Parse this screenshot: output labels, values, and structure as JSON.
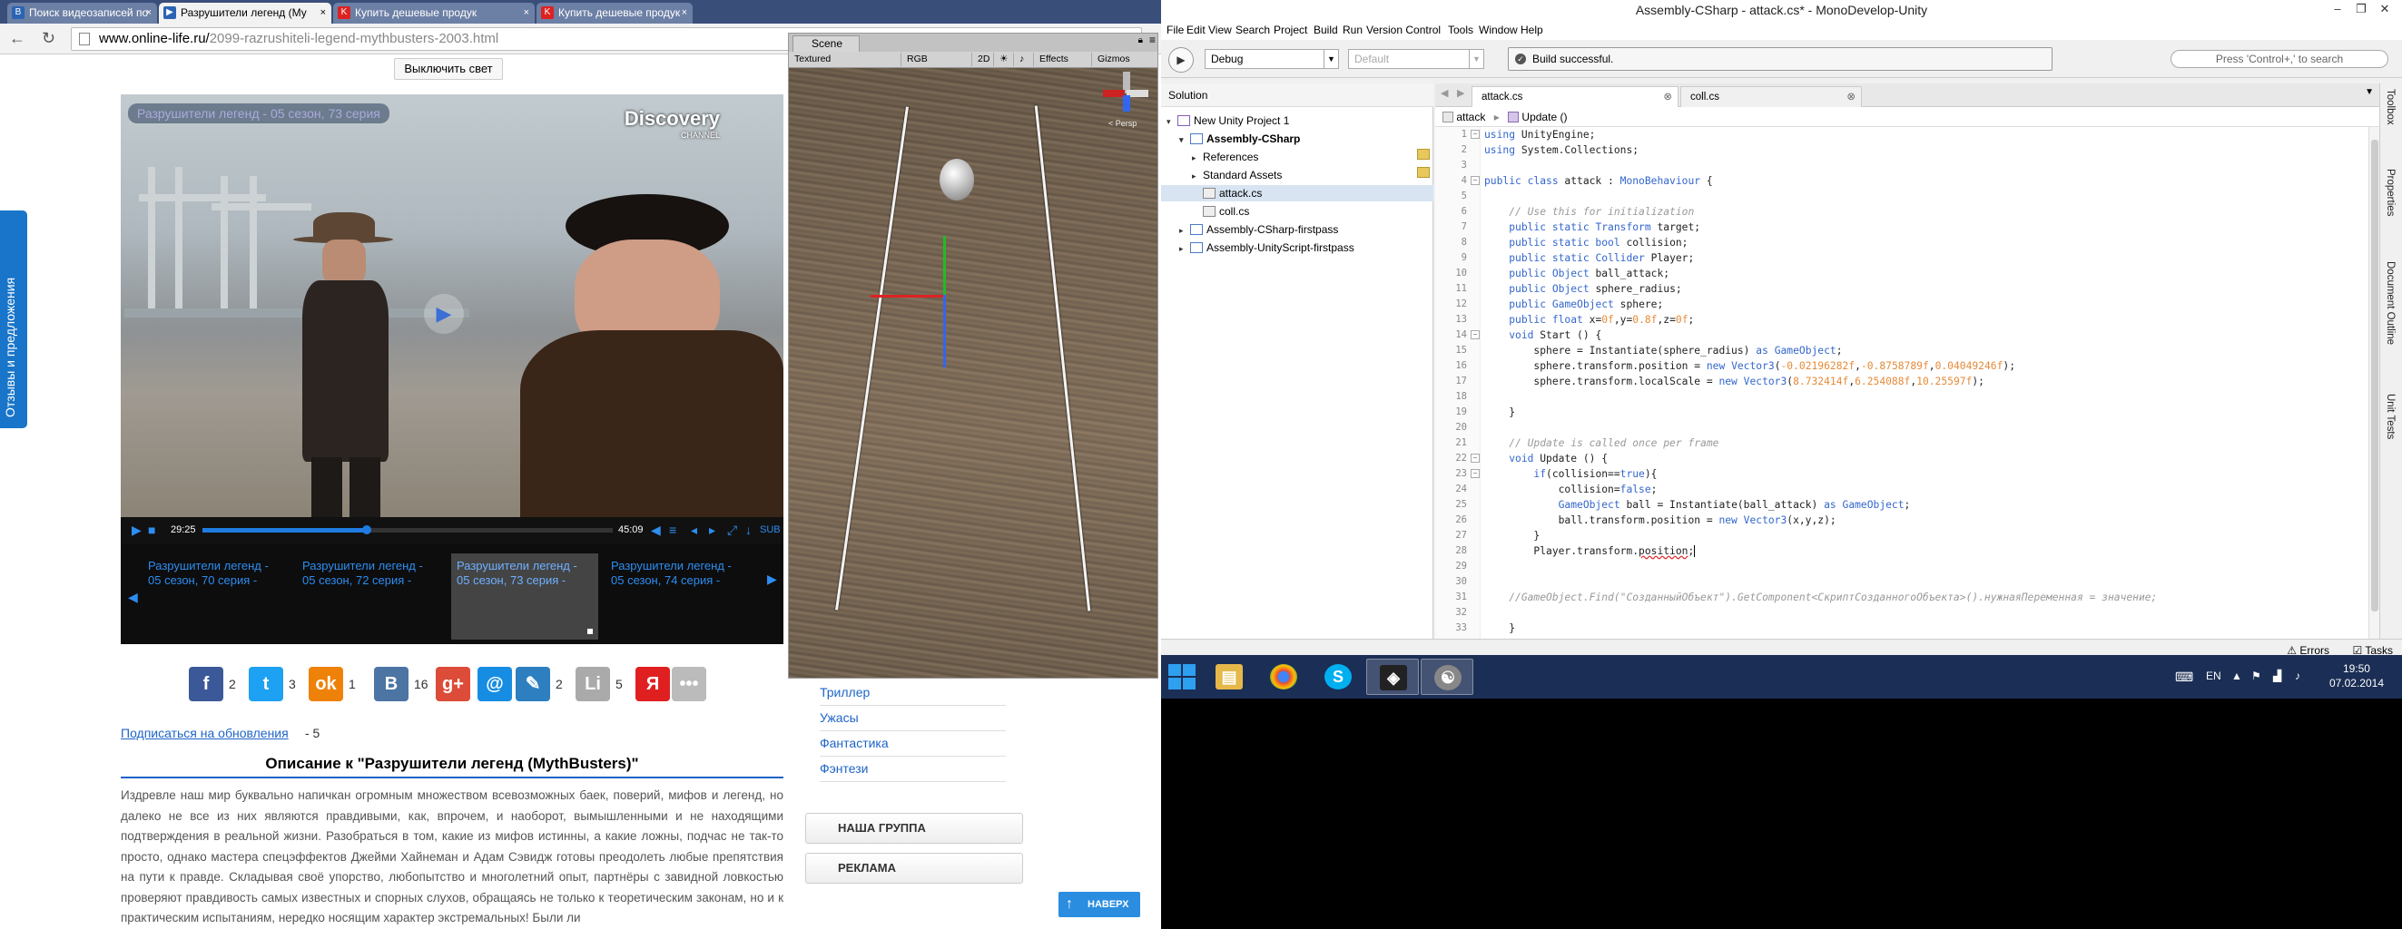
{
  "browser": {
    "tabs": [
      {
        "label": "Поиск видеозаписей по",
        "active": false,
        "icon": "vk-icon"
      },
      {
        "label": "Разрушители легенд (Му",
        "active": true,
        "icon": "video-site-icon"
      },
      {
        "label": "Купить дешевые продук",
        "active": false,
        "icon": "shop-icon"
      },
      {
        "label": "Купить дешевые продук",
        "active": false,
        "icon": "shop-icon"
      }
    ],
    "url_host": "www.online-life.ru/",
    "url_path": "2099-razrushiteli-legend-mythbusters-2003.html"
  },
  "site": {
    "lights_button": "Выключить свет",
    "feedback_tab": "Отзывы и предложения",
    "player": {
      "title_overlay": "Разрушители легенд - 05 сезон, 73 серия",
      "brand": "Discovery",
      "brand_sub": "CHANNEL",
      "time_current": "29:25",
      "time_total": "45:09",
      "sub_label": "SUB",
      "progress": 0.4,
      "playlist": [
        {
          "label": "Разрушители легенд - 05 сезон, 70 серия -",
          "active": false
        },
        {
          "label": "Разрушители легенд - 05 сезон, 72 серия -",
          "active": false
        },
        {
          "label": "Разрушители легенд - 05 сезон, 73 серия -",
          "active": true
        },
        {
          "label": "Разрушители легенд - 05 сезон, 74 серия -",
          "active": false
        }
      ]
    },
    "social": [
      {
        "icon": "facebook-icon",
        "glyph": "f",
        "color": "#3b5998",
        "count": "2"
      },
      {
        "icon": "twitter-icon",
        "glyph": "t",
        "color": "#1da1f2",
        "count": "3"
      },
      {
        "icon": "odnoklassniki-icon",
        "glyph": "ok",
        "color": "#ee8208",
        "count": "1"
      },
      {
        "icon": "vkontakte-icon",
        "glyph": "В",
        "color": "#4c75a3",
        "count": "16"
      },
      {
        "icon": "google-plus-icon",
        "glyph": "g+",
        "color": "#dd4b39",
        "count": ""
      },
      {
        "icon": "mailru-icon",
        "glyph": "@",
        "color": "#168de2",
        "count": ""
      },
      {
        "icon": "livejournal-icon",
        "glyph": "✎",
        "color": "#2d7fc0",
        "count": "2"
      },
      {
        "icon": "liveinternet-icon",
        "glyph": "Li",
        "color": "#aaaaaa",
        "count": "5"
      },
      {
        "icon": "yandex-icon",
        "glyph": "Я",
        "color": "#e02020",
        "count": ""
      },
      {
        "icon": "more-icon",
        "glyph": "•••",
        "color": "#bbbbbb",
        "count": ""
      }
    ],
    "subscribe_link": "Подписаться на обновления",
    "subscribe_count": "- 5",
    "description_title": "Описание к \"Разрушители легенд (MythBusters)\"",
    "description_text": "Издревле наш мир буквально напичкан огромным множеством всевозможных баек, поверий, мифов и легенд, но далеко не все из них являются правдивыми, как, впрочем, и наоборот, вымышленными и не находящими подтверждения в реальной жизни. Разобраться в том, какие из мифов истинны, а какие ложны, подчас не так-то просто, однако мастера спецэффектов Джейми Хайнеман и Адам Сэвидж готовы преодолеть любые препятствия на пути к правде. Складывая своё упорство, любопытство и многолетний опыт, партнёры с завидной ловкостью проверяют правдивость самых известных и спорных слухов, обращаясь не только к теоретическим законам, но и к практическим испытаниям, нередко носящим характер экстремальных! Были ли",
    "genres": [
      "Триллер",
      "Ужасы",
      "Фантастика",
      "Фэнтези"
    ],
    "side_boxes": [
      "НАША ГРУППА",
      "РЕКЛАМА"
    ],
    "to_top": "НАВЕРХ"
  },
  "scene": {
    "tab": "Scene",
    "toolbar": [
      "Textured",
      "RGB",
      "2D",
      "Effects",
      "Gizmos"
    ],
    "persp": "< Persp"
  },
  "monodevelop": {
    "title": "Assembly-CSharp - attack.cs* - MonoDevelop-Unity",
    "menu": [
      "File",
      "Edit",
      "View",
      "Search",
      "Project",
      "Build",
      "Run",
      "Version Control",
      "Tools",
      "Window",
      "Help"
    ],
    "config": "Debug",
    "platform": "Default",
    "build_status": "Build successful.",
    "search_placeholder": "Press 'Control+,' to search",
    "solution_header": "Solution",
    "solution_items": [
      {
        "label": "New Unity Project 1",
        "level": 0,
        "arrow": "▾",
        "kind": "sln",
        "bold": false,
        "selected": false
      },
      {
        "label": "Assembly-CSharp",
        "level": 1,
        "arrow": "▾",
        "kind": "proj",
        "bold": true,
        "selected": false
      },
      {
        "label": "References",
        "level": 2,
        "arrow": "▸",
        "kind": "fold",
        "bold": false,
        "selected": false
      },
      {
        "label": "Standard Assets",
        "level": 2,
        "arrow": "▸",
        "kind": "fold",
        "bold": false,
        "selected": false
      },
      {
        "label": "attack.cs",
        "level": 2,
        "arrow": "",
        "kind": "file",
        "bold": false,
        "selected": true
      },
      {
        "label": "coll.cs",
        "level": 2,
        "arrow": "",
        "kind": "file",
        "bold": false,
        "selected": false
      },
      {
        "label": "Assembly-CSharp-firstpass",
        "level": 1,
        "arrow": "▸",
        "kind": "proj",
        "bold": false,
        "selected": false
      },
      {
        "label": "Assembly-UnityScript-firstpass",
        "level": 1,
        "arrow": "▸",
        "kind": "proj",
        "bold": false,
        "selected": false
      }
    ],
    "editor_tabs": [
      {
        "label": "attack.cs",
        "active": true
      },
      {
        "label": "coll.cs",
        "active": false
      }
    ],
    "breadcrumb_class": "attack",
    "breadcrumb_method": "Update ()",
    "code_lines": [
      "1",
      "2",
      "3",
      "4",
      "5",
      "6",
      "7",
      "8",
      "9",
      "10",
      "11",
      "12",
      "13",
      "14",
      "15",
      "16",
      "17",
      "18",
      "19",
      "20",
      "21",
      "22",
      "23",
      "24",
      "25",
      "26",
      "27",
      "28",
      "29",
      "30",
      "31",
      "32",
      "33"
    ],
    "right_panels": [
      "Toolbox",
      "Properties",
      "Document Outline",
      "Unit Tests"
    ],
    "status_errors": "Errors",
    "status_tasks": "Tasks"
  },
  "taskbar": {
    "lang": "EN",
    "time": "19:50",
    "date": "07.02.2014"
  }
}
